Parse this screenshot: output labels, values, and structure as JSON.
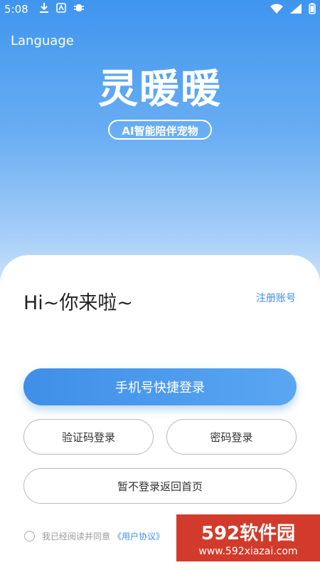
{
  "status": {
    "time": "5:08",
    "icons": [
      "download-icon",
      "app-icon",
      "bug-icon",
      "wifi-icon",
      "signal-icon",
      "battery-icon"
    ]
  },
  "header": {
    "language_label": "Language"
  },
  "logo": {
    "title": "灵暖暖",
    "subtitle": "AI智能陪伴宠物"
  },
  "login": {
    "greeting": "Hi~你来啦~",
    "register_label": "注册账号",
    "quick_login_label": "手机号快捷登录",
    "code_login_label": "验证码登录",
    "password_login_label": "密码登录",
    "skip_label": "暂不登录返回首页"
  },
  "agreement": {
    "text": "我已经阅读并同意",
    "link_label": "《用户协议》"
  },
  "watermark": {
    "brand": "592软件园",
    "url": "www.592xiazai.com"
  },
  "colors": {
    "accent": "#3f8fe8",
    "hero_top": "#3f95ef"
  }
}
